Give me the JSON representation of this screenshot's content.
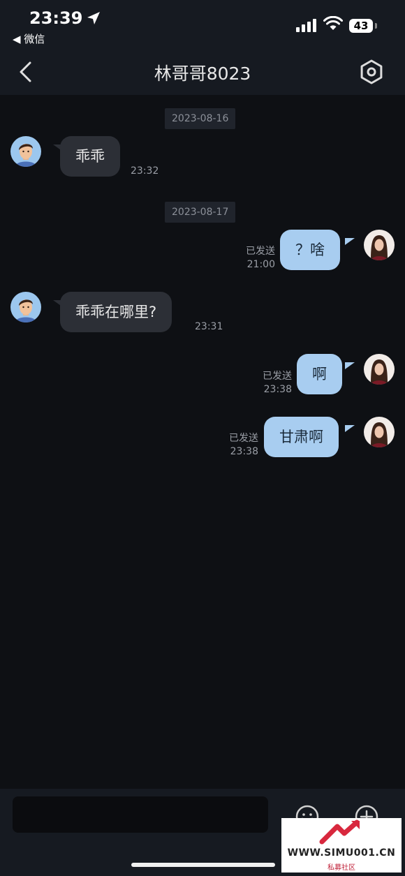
{
  "status_bar": {
    "time": "23:39",
    "back_app": "◀ 微信",
    "battery": "43"
  },
  "header": {
    "title": "林哥哥8023"
  },
  "messages": [
    {
      "type": "date",
      "text": "2023-08-16"
    },
    {
      "type": "in",
      "text": "乖乖",
      "time": "23:32"
    },
    {
      "type": "date",
      "text": "2023-08-17"
    },
    {
      "type": "out",
      "text": "？啥",
      "status": "已发送",
      "time": "21:00"
    },
    {
      "type": "in",
      "text": "乖乖在哪里?",
      "time": "23:31"
    },
    {
      "type": "out",
      "text": "啊",
      "status": "已发送",
      "time": "23:38"
    },
    {
      "type": "out",
      "text": "甘肃啊",
      "status": "已发送",
      "time": "23:38"
    }
  ],
  "input": {
    "placeholder": ""
  },
  "watermark": {
    "site": "WWW.SIMU001.CN",
    "sub": "私募社区"
  },
  "colors": {
    "background": "#0e1014",
    "bar": "#161a21",
    "incoming_bubble": "#2c2f36",
    "outgoing_bubble": "#a8cdf0",
    "meta_text": "#9a9ea6"
  }
}
